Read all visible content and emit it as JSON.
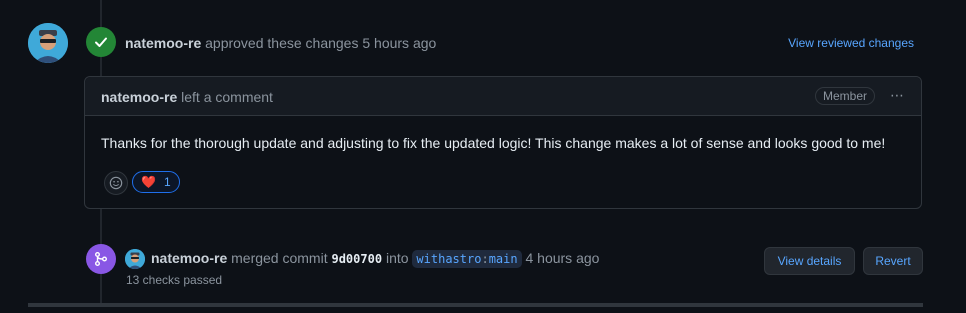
{
  "review": {
    "author": "natemoo-re",
    "action_text": "approved these changes 5 hours ago",
    "view_reviewed_label": "View reviewed changes"
  },
  "comment": {
    "author": "natemoo-re",
    "action_text": "left a comment",
    "role_badge": "Member",
    "more_icon": "⋯",
    "body": "Thanks for the thorough update and adjusting to fix the updated logic! This change makes a lot of sense and looks good to me!",
    "reactions": [
      {
        "icon": "heart",
        "emoji": "❤️",
        "count": "1"
      }
    ]
  },
  "merge": {
    "author": "natemoo-re",
    "merged_text": "merged commit",
    "commit_sha": "9d00700",
    "into_text": "into",
    "branch_owner": "withastro",
    "branch_sep": ":",
    "branch_name": "main",
    "time_text": "4 hours ago",
    "checks_text": "13 checks passed",
    "view_details_label": "View details",
    "revert_label": "Revert"
  },
  "colors": {
    "background": "#0d1117",
    "approved_green": "#238636",
    "merged_purple": "#8957e5",
    "link_blue": "#58a6ff"
  }
}
